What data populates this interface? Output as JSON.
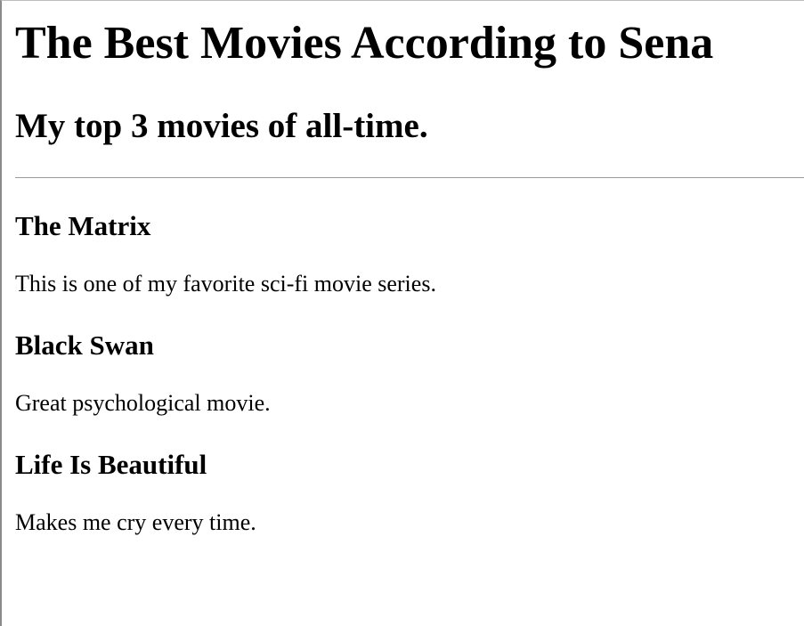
{
  "page": {
    "title": "The Best Movies According to Sena",
    "subtitle": "My top 3 movies of all-time."
  },
  "movies": [
    {
      "name": "The Matrix",
      "description": "This is one of my favorite sci-fi movie series."
    },
    {
      "name": "Black Swan",
      "description": "Great psychological movie."
    },
    {
      "name": "Life Is Beautiful",
      "description": "Makes me cry every time."
    }
  ]
}
